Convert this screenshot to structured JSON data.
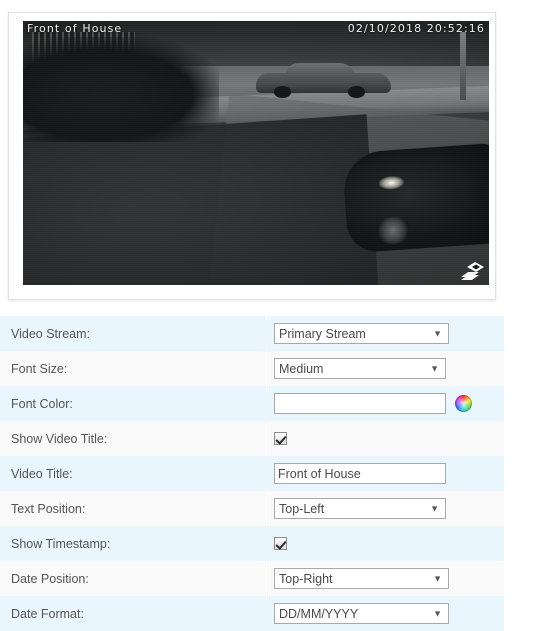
{
  "video_preview": {
    "overlay_title": "Front of House",
    "overlay_timestamp": "02/10/2018  20:52:16",
    "resize_handle_icon": "resize-handle-icon"
  },
  "settings": {
    "rows": [
      {
        "label": "Video Stream:",
        "type": "select",
        "value": "Primary Stream"
      },
      {
        "label": "Font Size:",
        "type": "select",
        "value": "Medium"
      },
      {
        "label": "Font Color:",
        "type": "color",
        "value": "",
        "icon": "color-wheel-icon"
      },
      {
        "label": "Show Video Title:",
        "type": "checkbox",
        "checked": true
      },
      {
        "label": "Video Title:",
        "type": "text",
        "value": "Front of House"
      },
      {
        "label": "Text Position:",
        "type": "select",
        "value": "Top-Left"
      },
      {
        "label": "Show Timestamp:",
        "type": "checkbox",
        "checked": true
      },
      {
        "label": "Date Position:",
        "type": "select",
        "value": "Top-Right"
      },
      {
        "label": "Date Format:",
        "type": "select",
        "value": "DD/MM/YYYY"
      }
    ]
  },
  "colors": {
    "row_odd": "#eaf6fd",
    "row_even": "#fafafa",
    "label_text": "#555555",
    "control_border": "#a9a9a9",
    "panel_border": "#e2e2e2"
  }
}
